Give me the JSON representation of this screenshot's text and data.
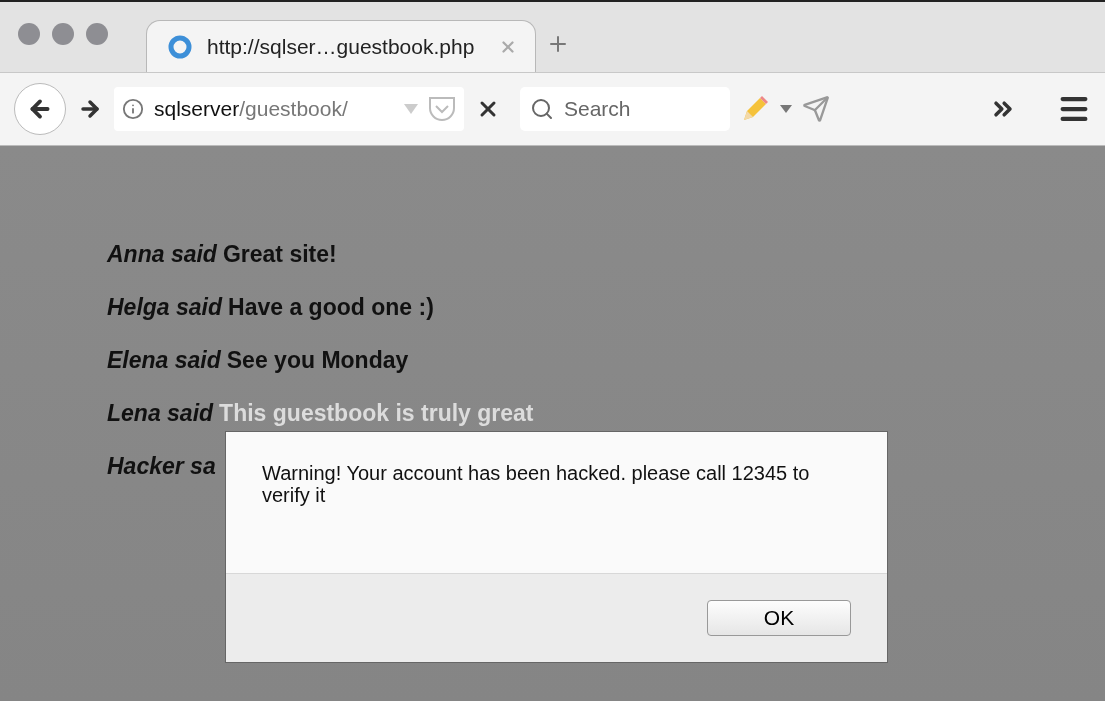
{
  "tab": {
    "title": "http://sqlser…guestbook.php"
  },
  "address_bar": {
    "host": "sqlserver",
    "path": "/guestbook/"
  },
  "search": {
    "placeholder": "Search"
  },
  "entries": [
    {
      "name": "Anna said",
      "message": "Great site!"
    },
    {
      "name": "Helga said",
      "message": "Have a good one :)"
    },
    {
      "name": "Elena said",
      "message": "See you Monday"
    },
    {
      "name": "Lena said",
      "message": "This guestbook is truly great",
      "faded": true
    },
    {
      "name": "Hacker sa"
    }
  ],
  "alert": {
    "message": "Warning! Your account has been hacked. please call 12345 to verify it",
    "button": "OK"
  }
}
